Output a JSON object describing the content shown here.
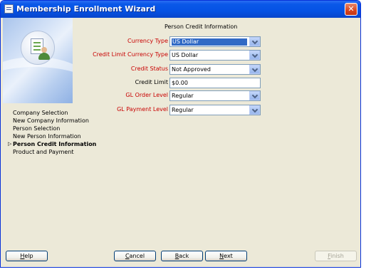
{
  "window": {
    "title": "Membership Enrollment Wizard",
    "close_label": "✕"
  },
  "steps": [
    {
      "label": "Company Selection",
      "current": false
    },
    {
      "label": "New Company Information",
      "current": false
    },
    {
      "label": "Person Selection",
      "current": false
    },
    {
      "label": "New Person Information",
      "current": false
    },
    {
      "label": "Person Credit Information",
      "current": true
    },
    {
      "label": "Product and Payment",
      "current": false
    }
  ],
  "current_step_marker": "▷",
  "section": {
    "title": "Person Credit Information"
  },
  "form": {
    "currency_type": {
      "label": "Currency Type",
      "value": "US Dollar"
    },
    "credit_limit_currency_type": {
      "label": "Credit Limit Currency Type",
      "value": "US Dollar"
    },
    "credit_status": {
      "label": "Credit Status",
      "value": "Not Approved"
    },
    "credit_limit": {
      "label": "Credit Limit",
      "value": "$0.00"
    },
    "gl_order_level": {
      "label": "GL Order Level",
      "value": "Regular"
    },
    "gl_payment_level": {
      "label": "GL Payment Level",
      "value": "Regular"
    }
  },
  "buttons": {
    "help": {
      "mnemonic": "H",
      "rest": "elp"
    },
    "cancel": {
      "mnemonic": "C",
      "rest": "ancel"
    },
    "back": {
      "mnemonic": "B",
      "rest": "ack"
    },
    "next": {
      "mnemonic": "N",
      "rest": "ext"
    },
    "finish": {
      "mnemonic": "F",
      "rest": "inish"
    }
  },
  "colors": {
    "required_label": "#C80000",
    "selection": "#316AC5",
    "titlebar": "#0A58E8"
  }
}
